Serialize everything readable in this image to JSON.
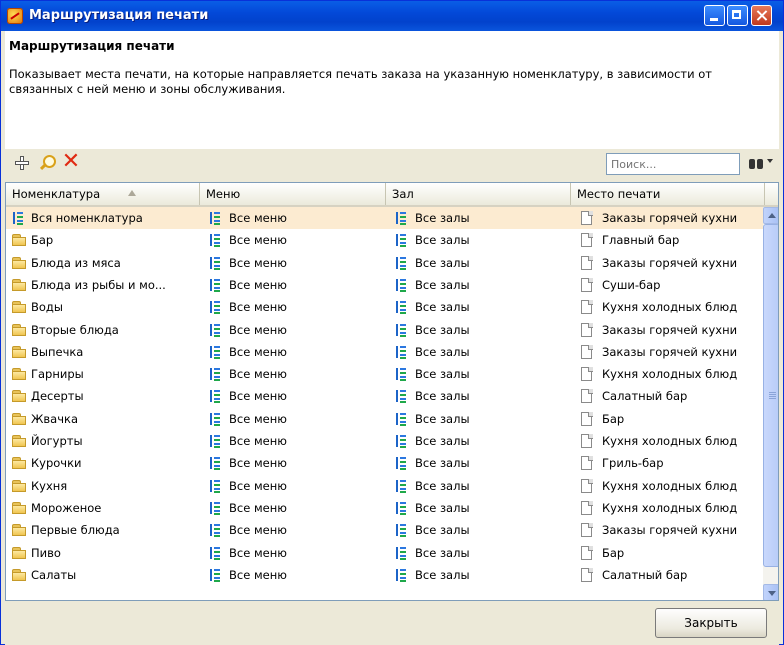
{
  "window": {
    "title": "Маршрутизация печати"
  },
  "header": {
    "title": "Маршрутизация печати",
    "description": "Показывает места печати, на которые направляется печать заказа на указанную номенклатуру, в зависимости от связанных с ней меню и зоны обслуживания."
  },
  "toolbar": {
    "add_icon": "plus-icon",
    "find_icon": "magnifier-icon",
    "delete_icon": "red-x-icon",
    "search_placeholder": "Поиск...",
    "search_value": ""
  },
  "grid": {
    "columns": [
      "Номенклатура",
      "Меню",
      "Зал",
      "Место печати"
    ],
    "sorted_column": "Номенклатура",
    "sort_direction": "ascending",
    "rows": [
      {
        "item": "Вся номенклатура",
        "item_icon": "tree-icon",
        "menu": "Все меню",
        "hall": "Все залы",
        "printer": "Заказы горячей кухни",
        "selected": true
      },
      {
        "item": "Бар",
        "item_icon": "folder-icon",
        "menu": "Все меню",
        "hall": "Все залы",
        "printer": "Главный бар"
      },
      {
        "item": "Блюда из мяса",
        "item_icon": "folder-icon",
        "menu": "Все меню",
        "hall": "Все залы",
        "printer": "Заказы горячей кухни"
      },
      {
        "item": "Блюда из рыбы и мо...",
        "item_icon": "folder-icon",
        "menu": "Все меню",
        "hall": "Все залы",
        "printer": "Суши-бар"
      },
      {
        "item": "Воды",
        "item_icon": "folder-icon",
        "menu": "Все меню",
        "hall": "Все залы",
        "printer": "Кухня холодных блюд"
      },
      {
        "item": "Вторые блюда",
        "item_icon": "folder-icon",
        "menu": "Все меню",
        "hall": "Все залы",
        "printer": "Заказы горячей кухни"
      },
      {
        "item": "Выпечка",
        "item_icon": "folder-icon",
        "menu": "Все меню",
        "hall": "Все залы",
        "printer": "Заказы горячей кухни"
      },
      {
        "item": "Гарниры",
        "item_icon": "folder-icon",
        "menu": "Все меню",
        "hall": "Все залы",
        "printer": "Кухня холодных блюд"
      },
      {
        "item": "Десерты",
        "item_icon": "folder-icon",
        "menu": "Все меню",
        "hall": "Все залы",
        "printer": "Салатный бар"
      },
      {
        "item": "Жвачка",
        "item_icon": "folder-icon",
        "menu": "Все меню",
        "hall": "Все залы",
        "printer": "Бар"
      },
      {
        "item": "Йогурты",
        "item_icon": "folder-icon",
        "menu": "Все меню",
        "hall": "Все залы",
        "printer": "Кухня холодных блюд"
      },
      {
        "item": "Курочки",
        "item_icon": "folder-icon",
        "menu": "Все меню",
        "hall": "Все залы",
        "printer": "Гриль-бар"
      },
      {
        "item": "Кухня",
        "item_icon": "folder-icon",
        "menu": "Все меню",
        "hall": "Все залы",
        "printer": "Кухня холодных блюд"
      },
      {
        "item": "Мороженое",
        "item_icon": "folder-icon",
        "menu": "Все меню",
        "hall": "Все залы",
        "printer": "Кухня холодных блюд"
      },
      {
        "item": "Первые блюда",
        "item_icon": "folder-icon",
        "menu": "Все меню",
        "hall": "Все залы",
        "printer": "Заказы горячей кухни"
      },
      {
        "item": "Пиво",
        "item_icon": "folder-icon",
        "menu": "Все меню",
        "hall": "Все залы",
        "printer": "Бар"
      },
      {
        "item": "Салаты",
        "item_icon": "folder-icon",
        "menu": "Все меню",
        "hall": "Все залы",
        "printer": "Салатный бар"
      }
    ]
  },
  "footer": {
    "close_label": "Закрыть"
  },
  "colors": {
    "titlebar": "#0348d8",
    "selected_row": "#fcebd1",
    "dialog_background": "#ece9d8"
  }
}
